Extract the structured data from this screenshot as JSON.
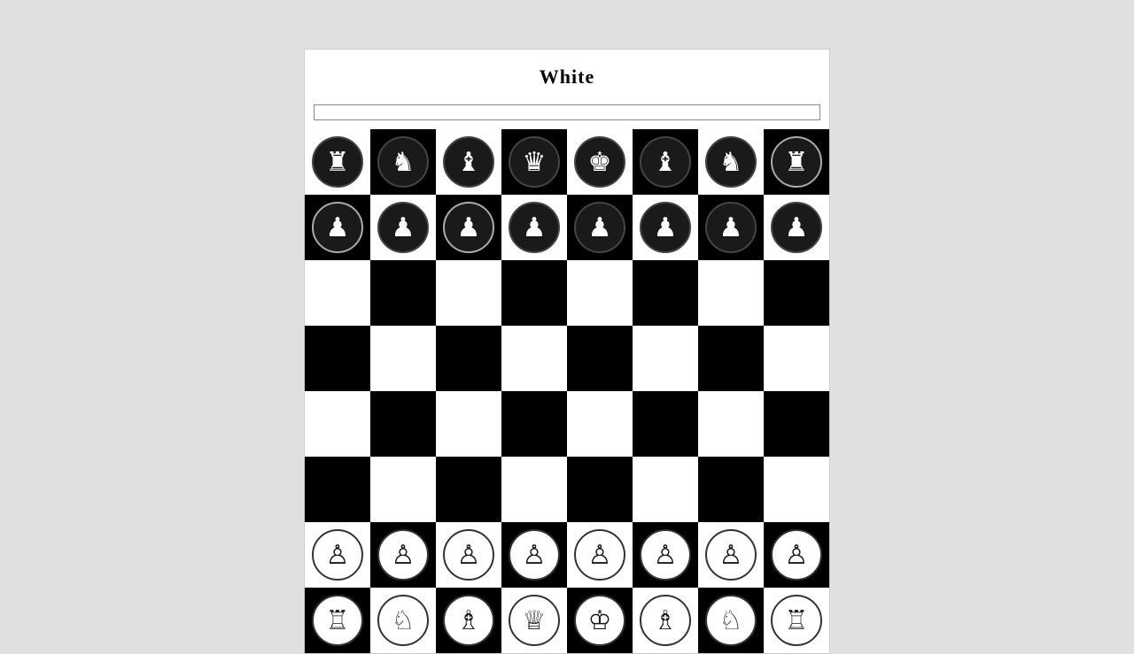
{
  "header": {
    "title": "White"
  },
  "board": {
    "rows": [
      [
        {
          "piece": "♜",
          "style": "dark",
          "bg": "white"
        },
        {
          "piece": "♞",
          "style": "dark",
          "bg": "black"
        },
        {
          "piece": "♝",
          "style": "dark",
          "bg": "white"
        },
        {
          "piece": "♛",
          "style": "dark",
          "bg": "black"
        },
        {
          "piece": "♚",
          "style": "dark",
          "bg": "white"
        },
        {
          "piece": "♝",
          "style": "dark",
          "bg": "black"
        },
        {
          "piece": "♞",
          "style": "dark",
          "bg": "white"
        },
        {
          "piece": "♜",
          "style": "dark-outlined",
          "bg": "black"
        }
      ],
      [
        {
          "piece": "♟",
          "style": "dark-outlined",
          "bg": "black"
        },
        {
          "piece": "♟",
          "style": "dark",
          "bg": "white"
        },
        {
          "piece": "♟",
          "style": "dark-outlined",
          "bg": "black"
        },
        {
          "piece": "♟",
          "style": "dark",
          "bg": "white"
        },
        {
          "piece": "♟",
          "style": "dark",
          "bg": "black"
        },
        {
          "piece": "♟",
          "style": "dark",
          "bg": "white"
        },
        {
          "piece": "♟",
          "style": "dark",
          "bg": "black"
        },
        {
          "piece": "♟",
          "style": "dark",
          "bg": "white"
        }
      ],
      [
        {
          "piece": "",
          "bg": "white"
        },
        {
          "piece": "",
          "bg": "black"
        },
        {
          "piece": "",
          "bg": "white"
        },
        {
          "piece": "",
          "bg": "black"
        },
        {
          "piece": "",
          "bg": "white"
        },
        {
          "piece": "",
          "bg": "black"
        },
        {
          "piece": "",
          "bg": "white"
        },
        {
          "piece": "",
          "bg": "black"
        }
      ],
      [
        {
          "piece": "",
          "bg": "black"
        },
        {
          "piece": "",
          "bg": "white"
        },
        {
          "piece": "",
          "bg": "black"
        },
        {
          "piece": "",
          "bg": "white"
        },
        {
          "piece": "",
          "bg": "black"
        },
        {
          "piece": "",
          "bg": "white"
        },
        {
          "piece": "",
          "bg": "black"
        },
        {
          "piece": "",
          "bg": "white"
        }
      ],
      [
        {
          "piece": "",
          "bg": "white"
        },
        {
          "piece": "",
          "bg": "black"
        },
        {
          "piece": "",
          "bg": "white"
        },
        {
          "piece": "",
          "bg": "black"
        },
        {
          "piece": "",
          "bg": "white"
        },
        {
          "piece": "",
          "bg": "black"
        },
        {
          "piece": "",
          "bg": "white"
        },
        {
          "piece": "",
          "bg": "black"
        }
      ],
      [
        {
          "piece": "",
          "bg": "black"
        },
        {
          "piece": "",
          "bg": "white"
        },
        {
          "piece": "",
          "bg": "black"
        },
        {
          "piece": "",
          "bg": "white"
        },
        {
          "piece": "",
          "bg": "black"
        },
        {
          "piece": "",
          "bg": "white"
        },
        {
          "piece": "",
          "bg": "black"
        },
        {
          "piece": "",
          "bg": "white"
        }
      ],
      [
        {
          "piece": "♙",
          "style": "light",
          "bg": "white"
        },
        {
          "piece": "♙",
          "style": "light",
          "bg": "black"
        },
        {
          "piece": "♙",
          "style": "light",
          "bg": "white"
        },
        {
          "piece": "♙",
          "style": "light",
          "bg": "black"
        },
        {
          "piece": "♙",
          "style": "light",
          "bg": "white"
        },
        {
          "piece": "♙",
          "style": "light",
          "bg": "black"
        },
        {
          "piece": "♙",
          "style": "light",
          "bg": "white"
        },
        {
          "piece": "♙",
          "style": "light",
          "bg": "black"
        }
      ],
      [
        {
          "piece": "♖",
          "style": "light",
          "bg": "black"
        },
        {
          "piece": "♘",
          "style": "light",
          "bg": "white"
        },
        {
          "piece": "♗",
          "style": "light",
          "bg": "black"
        },
        {
          "piece": "♕",
          "style": "light",
          "bg": "white"
        },
        {
          "piece": "♔",
          "style": "light",
          "bg": "black"
        },
        {
          "piece": "♗",
          "style": "light",
          "bg": "white"
        },
        {
          "piece": "♘",
          "style": "light",
          "bg": "black"
        },
        {
          "piece": "♖",
          "style": "light",
          "bg": "white"
        }
      ]
    ]
  }
}
